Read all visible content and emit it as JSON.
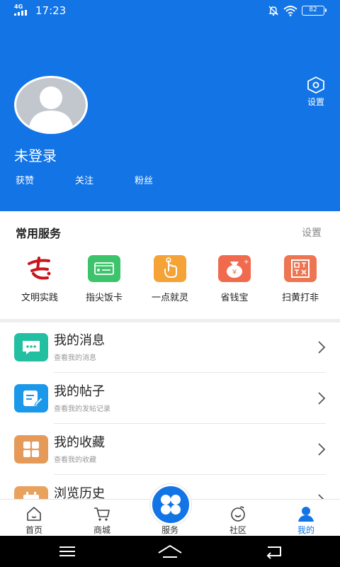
{
  "status_bar": {
    "network": "4G",
    "time": "17:23",
    "battery": "82"
  },
  "profile": {
    "login_status": "未登录",
    "stats": [
      "获赞",
      "关注",
      "粉丝"
    ],
    "settings_label": "设置"
  },
  "common_services": {
    "title": "常用服务",
    "settings_label": "设置",
    "items": [
      {
        "label": "文明实践",
        "icon": "wenming-logo-icon",
        "color": "#FFFFFF"
      },
      {
        "label": "指尖饭卡",
        "icon": "card-icon",
        "color": "#3CC36B"
      },
      {
        "label": "一点就灵",
        "icon": "finger-tap-icon",
        "color": "#F5A236"
      },
      {
        "label": "省钱宝",
        "icon": "money-bag-icon",
        "color": "#F06A4E"
      },
      {
        "label": "扫黄打非",
        "icon": "seal-icon",
        "color": "#EE7552"
      }
    ]
  },
  "menu": [
    {
      "title": "我的消息",
      "subtitle": "查看我的消息",
      "icon": "message-icon",
      "color": "#22C0A0"
    },
    {
      "title": "我的帖子",
      "subtitle": "查看我的发帖记录",
      "icon": "post-edit-icon",
      "color": "#1C98EB"
    },
    {
      "title": "我的收藏",
      "subtitle": "查看我的收藏",
      "icon": "grid-collection-icon",
      "color": "#E59A5A"
    },
    {
      "title": "浏览历史",
      "subtitle": "",
      "icon": "calendar-history-icon",
      "color": "#E9A25E"
    }
  ],
  "bottom_nav": [
    {
      "label": "首页",
      "icon": "home-icon"
    },
    {
      "label": "商城",
      "icon": "cart-icon"
    },
    {
      "label": "服务",
      "icon": "clover-service-icon"
    },
    {
      "label": "社区",
      "icon": "community-icon"
    },
    {
      "label": "我的",
      "icon": "user-icon",
      "active": true
    }
  ],
  "colors": {
    "primary": "#1374E6",
    "divider": "#EEEEEE"
  }
}
